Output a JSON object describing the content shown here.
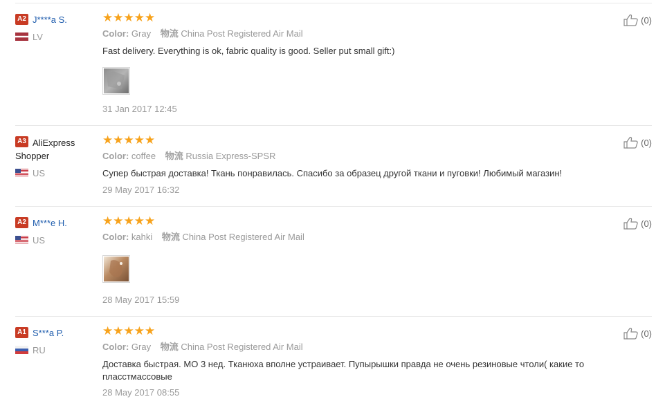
{
  "reviews": [
    {
      "level": "A2",
      "name": "J****a S.",
      "country": "LV",
      "flag": "lv",
      "color_label": "Color:",
      "color": "Gray",
      "shipping_cn": "物流",
      "shipping": "China Post Registered Air Mail",
      "text": "Fast delivery. Everything is ok, fabric quality is good. Seller put small gift:)",
      "has_photo": true,
      "date": "31 Jan 2017 12:45",
      "useful": "(0)"
    },
    {
      "level": "A3",
      "name": "AliExpress Shopper",
      "country": "US",
      "flag": "us",
      "color_label": "Color:",
      "color": "coffee",
      "shipping_cn": "物流",
      "shipping": "Russia Express-SPSR",
      "text": "Супер быстрая доставка! Ткань понравилась. Спасибо за образец другой ткани и пуговки! Любимый магазин!",
      "has_photo": false,
      "date": "29 May 2017 16:32",
      "useful": "(0)"
    },
    {
      "level": "A2",
      "name": "M***e H.",
      "country": "US",
      "flag": "us",
      "color_label": "Color:",
      "color": "kahki",
      "shipping_cn": "物流",
      "shipping": "China Post Registered Air Mail",
      "text": "",
      "has_photo": true,
      "date": "28 May 2017 15:59",
      "useful": "(0)"
    },
    {
      "level": "A1",
      "name": "S***a P.",
      "country": "RU",
      "flag": "ru",
      "color_label": "Color:",
      "color": "Gray",
      "shipping_cn": "物流",
      "shipping": "China Post Registered Air Mail",
      "text": "Доставка быстрая. МО 3 нед. Тканюха вполне устраивает. Пупырышки правда не очень резиновые чтоли( какие то пласстмассовые",
      "has_photo": false,
      "date": "28 May 2017 08:55",
      "useful": "(0)"
    }
  ],
  "rating": {
    "stars": 5,
    "star_glyph": "★"
  },
  "colors": {
    "star": "#f7a21b",
    "level_badge": "#c83b24",
    "username_link": "#1e5cad"
  }
}
